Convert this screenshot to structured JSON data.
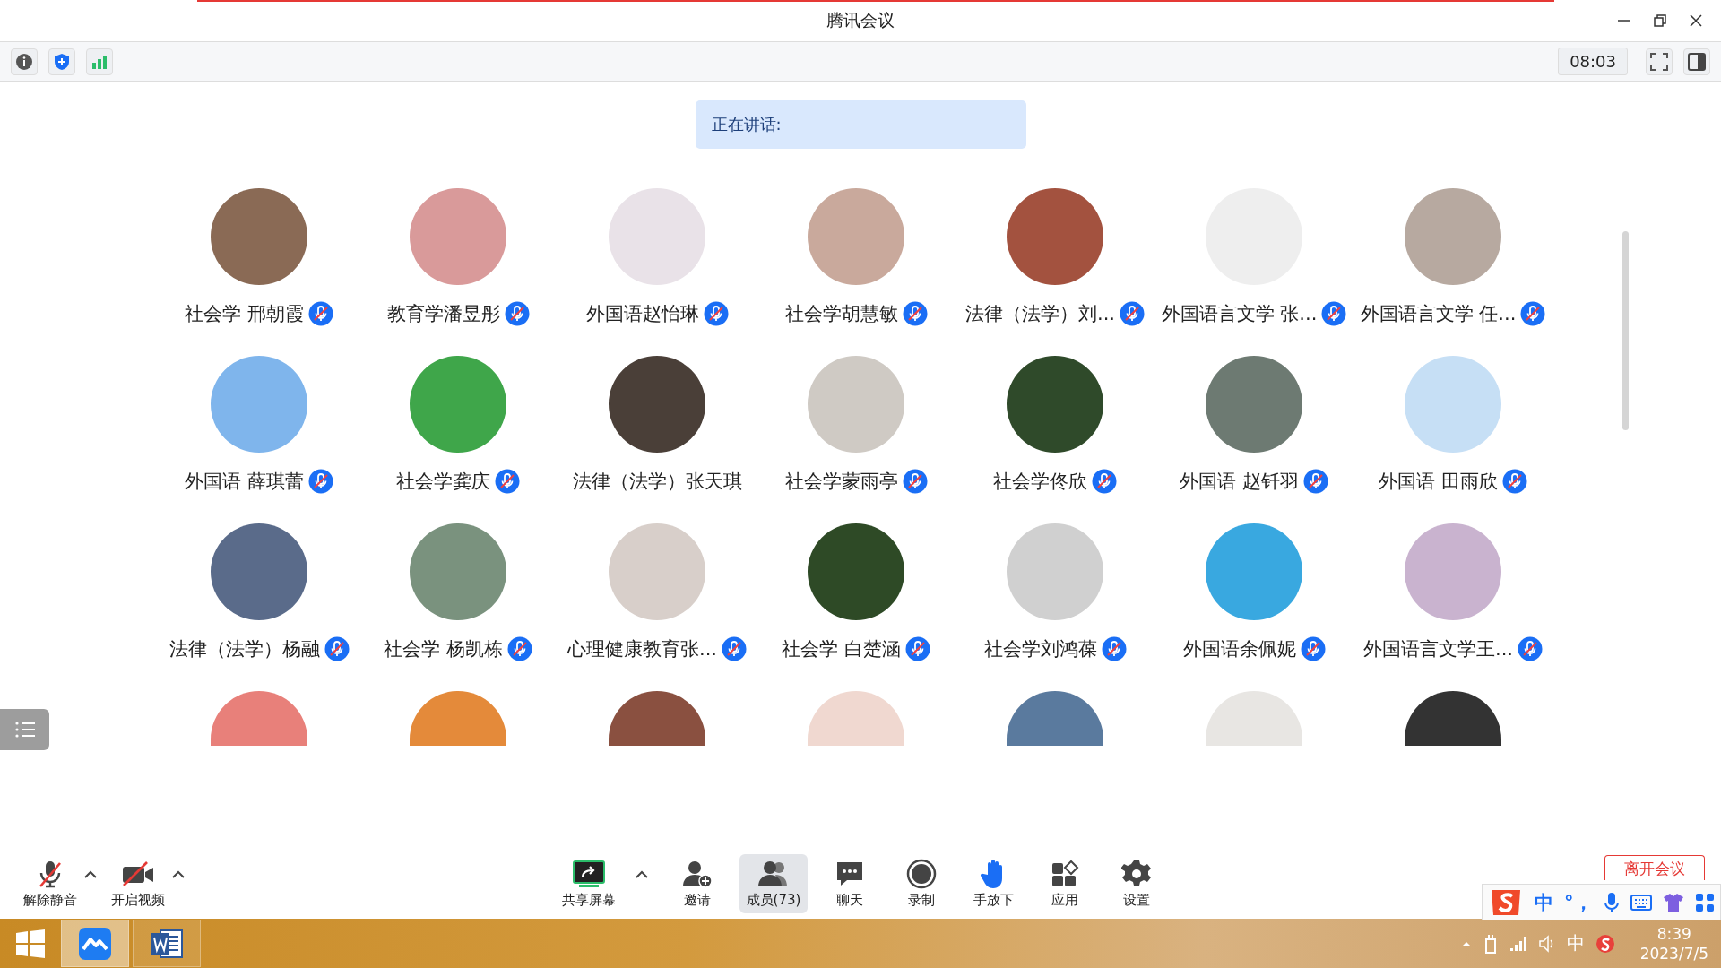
{
  "window": {
    "title": "腾讯会议"
  },
  "toolbar": {
    "timer": "08:03"
  },
  "speaking_banner": {
    "label": "正在讲话:"
  },
  "participants": [
    {
      "kind": "tile",
      "name": "社会学 邢朝霞",
      "muted": true
    },
    {
      "kind": "tile",
      "name": "教育学潘昱彤",
      "muted": true
    },
    {
      "kind": "tile",
      "name": "外国语赵怡琳",
      "muted": true
    },
    {
      "kind": "tile",
      "name": "社会学胡慧敏",
      "muted": true
    },
    {
      "kind": "tile",
      "name": "法律（法学）刘...",
      "muted": true
    },
    {
      "kind": "tile",
      "name": "外国语言文学 张...",
      "muted": true
    },
    {
      "kind": "tile",
      "name": "外国语言文学 任...",
      "muted": true
    },
    {
      "kind": "tile",
      "name": "外国语 薛琪蕾",
      "muted": true
    },
    {
      "kind": "tile",
      "name": "社会学龚庆",
      "muted": true
    },
    {
      "kind": "tile",
      "name": "法律（法学）张天琪",
      "muted": false
    },
    {
      "kind": "tile",
      "name": "社会学蒙雨亭",
      "muted": true
    },
    {
      "kind": "tile",
      "name": "社会学佟欣",
      "muted": true
    },
    {
      "kind": "tile",
      "name": "外国语 赵钎羽",
      "muted": true
    },
    {
      "kind": "tile",
      "name": "外国语 田雨欣",
      "muted": true
    },
    {
      "kind": "tile",
      "name": "法律（法学）杨融",
      "muted": true
    },
    {
      "kind": "tile",
      "name": "社会学 杨凯栋",
      "muted": true
    },
    {
      "kind": "tile",
      "name": "心理健康教育张...",
      "muted": true
    },
    {
      "kind": "tile",
      "name": "社会学 白楚涵",
      "muted": true
    },
    {
      "kind": "tile",
      "name": "社会学刘鸿葆",
      "muted": true
    },
    {
      "kind": "tile",
      "name": "外国语余佩妮",
      "muted": true
    },
    {
      "kind": "tile",
      "name": "外国语言文学王...",
      "muted": true
    },
    {
      "kind": "partial"
    },
    {
      "kind": "partial"
    },
    {
      "kind": "partial"
    },
    {
      "kind": "partial"
    },
    {
      "kind": "partial"
    },
    {
      "kind": "partial"
    },
    {
      "kind": "partial"
    }
  ],
  "controls": [
    {
      "kind": "mic",
      "label": "解除静音",
      "caret": true,
      "selected": false
    },
    {
      "kind": "video",
      "label": "开启视频",
      "caret": true,
      "selected": false
    },
    {
      "kind": "share",
      "label": "共享屏幕",
      "caret": true,
      "selected": false
    },
    {
      "kind": "invite",
      "label": "邀请",
      "caret": false,
      "selected": false
    },
    {
      "kind": "members",
      "label": "成员(73)",
      "caret": false,
      "selected": true
    },
    {
      "kind": "chat",
      "label": "聊天",
      "caret": false,
      "selected": false
    },
    {
      "kind": "record",
      "label": "录制",
      "caret": false,
      "selected": false
    },
    {
      "kind": "hand",
      "label": "手放下",
      "caret": false,
      "selected": false
    },
    {
      "kind": "apps",
      "label": "应用",
      "caret": false,
      "selected": false
    },
    {
      "kind": "settings",
      "label": "设置",
      "caret": false,
      "selected": false
    }
  ],
  "leave_button": {
    "label": "离开会议"
  },
  "taskbar": {
    "apps": [
      {
        "kind": "meeting",
        "selected": true
      },
      {
        "kind": "word",
        "selected": false
      }
    ],
    "tray_ime": "中",
    "time": "8:39",
    "date": "2023/7/5"
  },
  "ime_bar": {
    "mode": "中",
    "punctuation": "°，"
  }
}
